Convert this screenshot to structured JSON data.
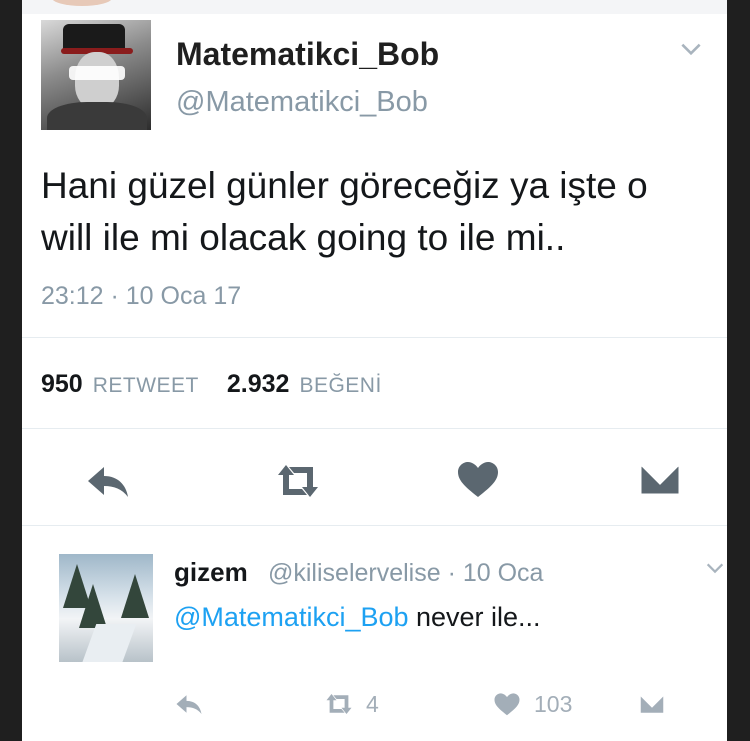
{
  "tweet": {
    "display_name": "Matematikci_Bob",
    "handle": "@Matematikci_Bob",
    "text_line1": "Hani güzel günler göreceğiz ya işte o",
    "text_line2": "will ile mi olacak going to ile mi..",
    "timestamp": "23:12 · 10 Oca 17",
    "retweet_count": "950",
    "retweet_label": "RETWEET",
    "like_count": "2.932",
    "like_label": "BEĞENİ",
    "actions": {
      "reply_icon": "reply-icon",
      "retweet_icon": "retweet-icon",
      "like_icon": "heart-icon",
      "dm_icon": "envelope-icon"
    }
  },
  "reply": {
    "display_name": "gizem",
    "meta": "@kiliselervelise · 10 Oca",
    "mention": "@Matematikci_Bob",
    "text": " never ile...",
    "retweet_count": "4",
    "like_count": "103"
  },
  "colors": {
    "background": "#1f1f1f",
    "card": "#ffffff",
    "muted": "#8899a6",
    "link": "#1da1f2"
  }
}
